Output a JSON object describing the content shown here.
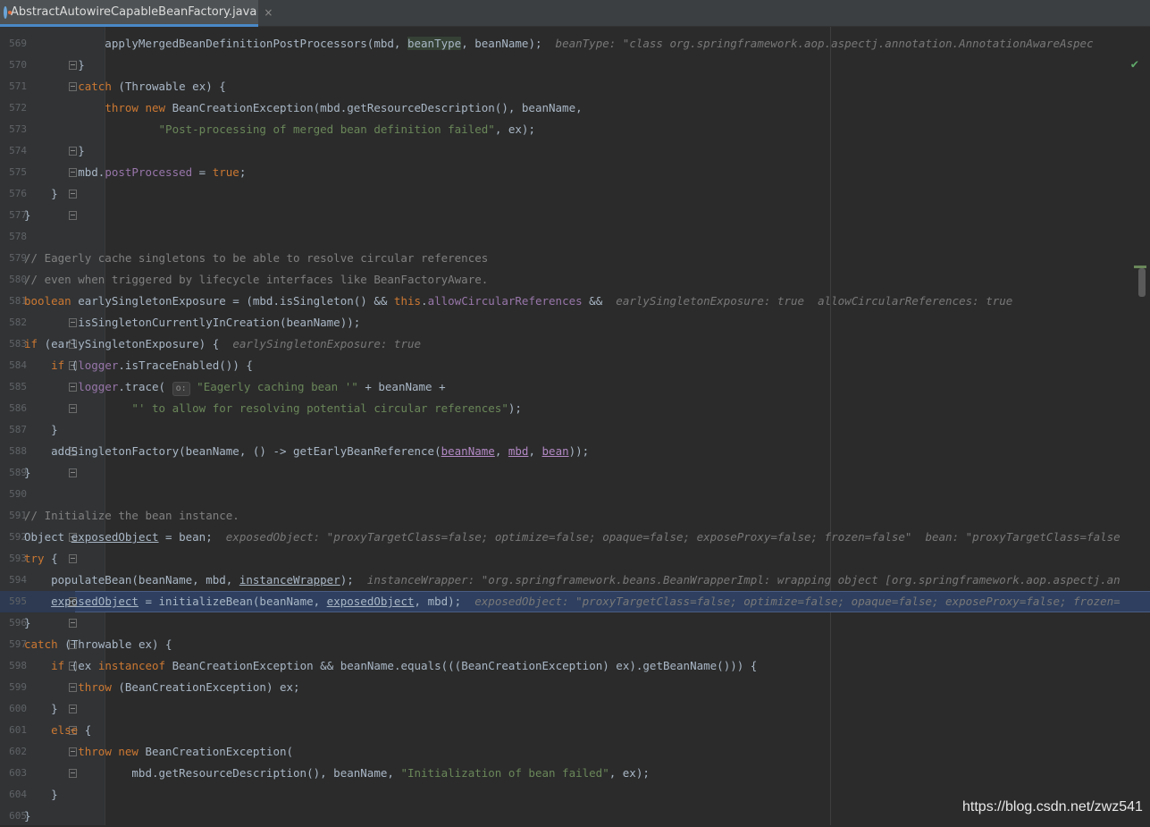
{
  "tab": {
    "title": "AbstractAutowireCapableBeanFactory.java",
    "close": "×"
  },
  "lines": [
    {
      "n": "569",
      "html": "            applyMergedBeanDefinitionPostProcessors(mbd, <span class=\"hlvar\">beanType</span>, beanName);  <span class=\"hint\">beanType: \"class org.springframework.aop.aspectj.annotation.AnnotationAwareAspec</span>"
    },
    {
      "n": "570",
      "html": "        }"
    },
    {
      "n": "571",
      "html": "        <span class=\"kw\">catch</span> (Throwable ex) {"
    },
    {
      "n": "572",
      "html": "            <span class=\"kw\">throw new</span> BeanCreationException(mbd.getResourceDescription(), beanName,"
    },
    {
      "n": "573",
      "html": "                    <span class=\"str\">\"Post-processing of merged bean definition failed\"</span>, ex);"
    },
    {
      "n": "574",
      "html": "        }"
    },
    {
      "n": "575",
      "html": "        mbd.<span class=\"fld\">postProcessed</span> = <span class=\"kw\">true</span>;"
    },
    {
      "n": "576",
      "html": "    }"
    },
    {
      "n": "577",
      "html": "}"
    },
    {
      "n": "578",
      "html": ""
    },
    {
      "n": "579",
      "html": "<span class=\"cm\">// Eagerly cache singletons to be able to resolve circular references</span>"
    },
    {
      "n": "580",
      "html": "<span class=\"cm\">// even when triggered by lifecycle interfaces like BeanFactoryAware.</span>"
    },
    {
      "n": "581",
      "html": "<span class=\"kw\">boolean</span> earlySingletonExposure = (mbd.isSingleton() &amp;&amp; <span class=\"kw\">this</span>.<span class=\"fld\">allowCircularReferences</span> &amp;&amp;  <span class=\"hint\">earlySingletonExposure: true  allowCircularReferences: true</span>"
    },
    {
      "n": "582",
      "html": "        isSingletonCurrentlyInCreation(beanName));"
    },
    {
      "n": "583",
      "html": "<span class=\"kw\">if</span> (earlySingletonExposure) {  <span class=\"hint\">earlySingletonExposure: true</span>"
    },
    {
      "n": "584",
      "html": "    <span class=\"kw\">if</span> (<span class=\"fld\">logger</span>.isTraceEnabled()) {"
    },
    {
      "n": "585",
      "html": "        <span class=\"fld\">logger</span>.trace( <span class=\"pbox\">o:</span> <span class=\"str\">\"Eagerly caching bean '\"</span> + beanName +"
    },
    {
      "n": "586",
      "html": "                <span class=\"str\">\"' to allow for resolving potential circular references\"</span>);"
    },
    {
      "n": "587",
      "html": "    }"
    },
    {
      "n": "588",
      "html": "    addSingletonFactory(beanName, () -&gt; getEarlyBeanReference(<span class=\"uv\">beanName</span>, <span class=\"uv\">mbd</span>, <span class=\"uv\">bean</span>));"
    },
    {
      "n": "589",
      "html": "}"
    },
    {
      "n": "590",
      "html": ""
    },
    {
      "n": "591",
      "html": "<span class=\"cm\">// Initialize the bean instance.</span>"
    },
    {
      "n": "592",
      "html": "Object <span class=\"ul\">exposedObject</span> = bean;  <span class=\"hint\">exposedObject: \"proxyTargetClass=false; optimize=false; opaque=false; exposeProxy=false; frozen=false\"  bean: \"proxyTargetClass=false</span>"
    },
    {
      "n": "593",
      "html": "<span class=\"kw\">try</span> {"
    },
    {
      "n": "594",
      "html": "    populateBean(beanName, mbd, <span class=\"ul\">instanceWrapper</span>);  <span class=\"hint\">instanceWrapper: \"org.springframework.beans.BeanWrapperImpl: wrapping object [org.springframework.aop.aspectj.an</span>"
    },
    {
      "n": "595",
      "html": "    <span class=\"ul\">exposedObject</span> = initializeBean(beanName, <span class=\"ul\">exposedObject</span>, mbd);  <span class=\"hint\">exposedObject: \"proxyTargetClass=false; optimize=false; opaque=false; exposeProxy=false; frozen=</span>"
    },
    {
      "n": "596",
      "html": "}"
    },
    {
      "n": "597",
      "html": "<span class=\"kw\">catch</span> (Throwable ex) {"
    },
    {
      "n": "598",
      "html": "    <span class=\"kw\">if</span> (ex <span class=\"kw\">instanceof</span> BeanCreationException &amp;&amp; beanName.equals(((BeanCreationException) ex).getBeanName())) {"
    },
    {
      "n": "599",
      "html": "        <span class=\"kw\">throw</span> (BeanCreationException) ex;"
    },
    {
      "n": "600",
      "html": "    }"
    },
    {
      "n": "601",
      "html": "    <span class=\"kw\">else</span> {"
    },
    {
      "n": "602",
      "html": "        <span class=\"kw\">throw new</span> BeanCreationException("
    },
    {
      "n": "603",
      "html": "                mbd.getResourceDescription(), beanName, <span class=\"str\">\"Initialization of bean failed\"</span>, ex);"
    },
    {
      "n": "604",
      "html": "    }"
    },
    {
      "n": "605",
      "html": "}"
    }
  ],
  "watermark": "https://blog.csdn.net/zwz541",
  "inspection_status": "✔"
}
